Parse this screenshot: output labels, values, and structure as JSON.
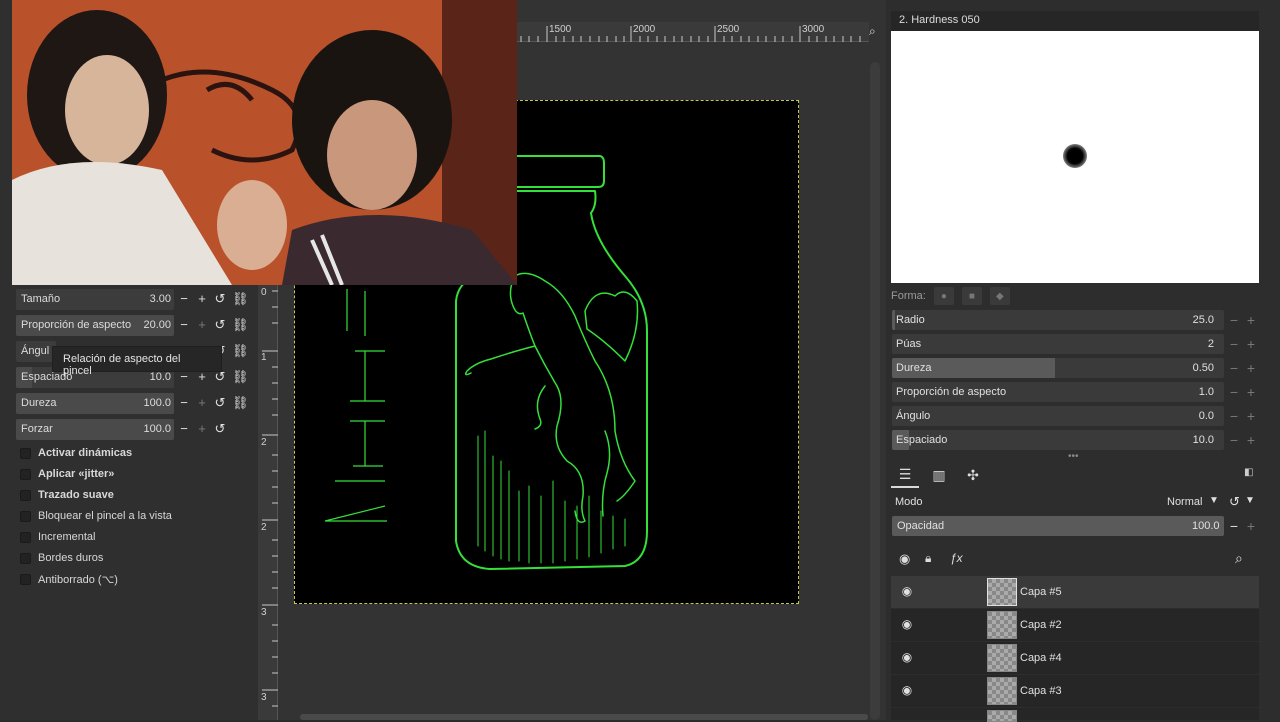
{
  "tool_options": {
    "sliders": [
      {
        "label": "Tamaño",
        "value": "3.00"
      },
      {
        "label": "Proporción de aspecto",
        "value": "20.00"
      },
      {
        "label": "Ángul",
        "value": ""
      },
      {
        "label": "Espaciado",
        "value": "10.0"
      },
      {
        "label": "Dureza",
        "value": "100.0"
      },
      {
        "label": "Forzar",
        "value": "100.0"
      }
    ],
    "tooltip": "Relación de aspecto del pincel",
    "checks": [
      {
        "label": "Activar dinámicas"
      },
      {
        "label": "Aplicar «jitter»"
      },
      {
        "label": "Trazado suave"
      },
      {
        "label": "Bloquear el pincel a la vista"
      },
      {
        "label": "Incremental"
      },
      {
        "label": "Bordes duros"
      },
      {
        "label": "Antiborrado  (⌥)"
      }
    ]
  },
  "ruler": {
    "h_ticks": [
      "1500",
      "2000",
      "2500",
      "3000"
    ],
    "v_ticks": [
      "0",
      "1",
      "2",
      "2",
      "3",
      "3"
    ]
  },
  "brush": {
    "title": "2. Hardness 050",
    "forma_label": "Forma:",
    "params": [
      {
        "label": "Radio",
        "value": "25.0"
      },
      {
        "label": "Púas",
        "value": "2"
      },
      {
        "label": "Dureza",
        "value": "0.50"
      },
      {
        "label": "Proporción de aspecto",
        "value": "1.0"
      },
      {
        "label": "Ángulo",
        "value": "0.0"
      },
      {
        "label": "Espaciado",
        "value": "10.0"
      }
    ]
  },
  "layers": {
    "mode_label": "Modo",
    "mode_value": "Normal",
    "opacity_label": "Opacidad",
    "opacity_value": "100.0",
    "items": [
      {
        "name": "Capa #5"
      },
      {
        "name": "Capa #2"
      },
      {
        "name": "Capa #4"
      },
      {
        "name": "Capa #3"
      }
    ]
  }
}
